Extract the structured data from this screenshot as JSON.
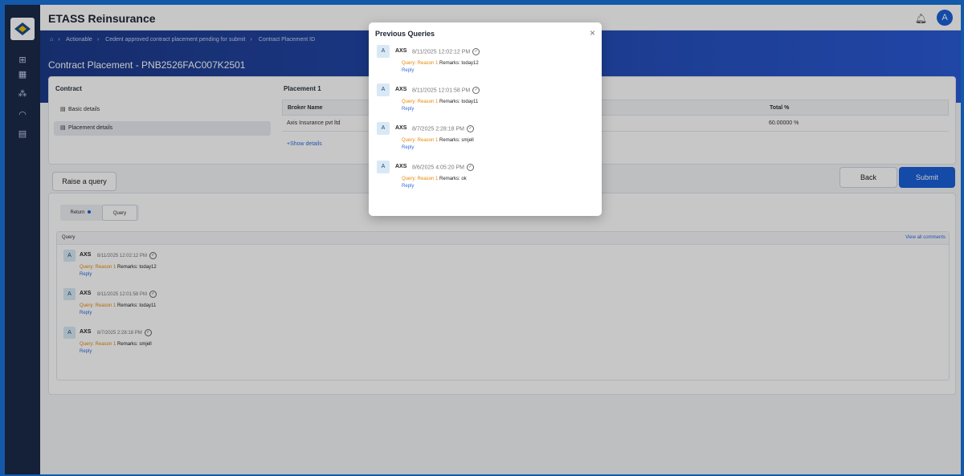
{
  "app": {
    "title": "ETASS Reinsurance",
    "avatar": "A"
  },
  "breadcrumb": [
    "Actionable",
    "Cedent approved contract placement pending for submit",
    "Contract Placement ID"
  ],
  "page_title": "Contract Placement - PNB2526FAC007K2501",
  "contract": {
    "title": "Contract",
    "nav": [
      "Basic details",
      "Placement details"
    ]
  },
  "placement": {
    "title": "Placement 1",
    "headers": {
      "broker": "Broker Name",
      "total": "Total %"
    },
    "row": {
      "broker": "Axis Insurance pvt ltd",
      "total": "60.00000 %"
    },
    "show_details": "+Show details"
  },
  "actions": {
    "raise": "Raise a query",
    "back": "Back",
    "submit": "Submit"
  },
  "tabs": {
    "return": "Return",
    "query": "Query"
  },
  "query_section": {
    "label": "Query",
    "view_all": "View all comments"
  },
  "comments": [
    {
      "avatar": "A",
      "user": "AXS",
      "time": "8/11/2025 12:02:12 PM",
      "qlabel": "Query: Reason 1",
      "remarks": "Remarks: today12",
      "reply": "Reply"
    },
    {
      "avatar": "A",
      "user": "AXS",
      "time": "8/11/2025 12:01:58 PM",
      "qlabel": "Query: Reason 1",
      "remarks": "Remarks: today11",
      "reply": "Reply"
    },
    {
      "avatar": "A",
      "user": "AXS",
      "time": "8/7/2025 2:28:18 PM",
      "qlabel": "Query: Reason 1",
      "remarks": "Remarks: smjell",
      "reply": "Reply"
    }
  ],
  "modal": {
    "title": "Previous Queries",
    "close": "×",
    "comments": [
      {
        "avatar": "A",
        "user": "AXS",
        "time": "8/11/2025 12:02:12 PM",
        "qlabel": "Query: Reason 1",
        "remarks": "Remarks: today12",
        "reply": "Reply"
      },
      {
        "avatar": "A",
        "user": "AXS",
        "time": "8/11/2025 12:01:58 PM",
        "qlabel": "Query: Reason 1",
        "remarks": "Remarks: today11",
        "reply": "Reply"
      },
      {
        "avatar": "A",
        "user": "AXS",
        "time": "8/7/2025 2:28:18 PM",
        "qlabel": "Query: Reason 1",
        "remarks": "Remarks: smjell",
        "reply": "Reply"
      },
      {
        "avatar": "A",
        "user": "AXS",
        "time": "8/6/2025 4:05:20 PM",
        "qlabel": "Query: Reason 1",
        "remarks": "Remarks: ok",
        "reply": "Reply"
      }
    ]
  },
  "colors": {
    "brand": "#1a5fd8",
    "query_label": "#e58a08",
    "sidebar": "#1b2a4a"
  }
}
